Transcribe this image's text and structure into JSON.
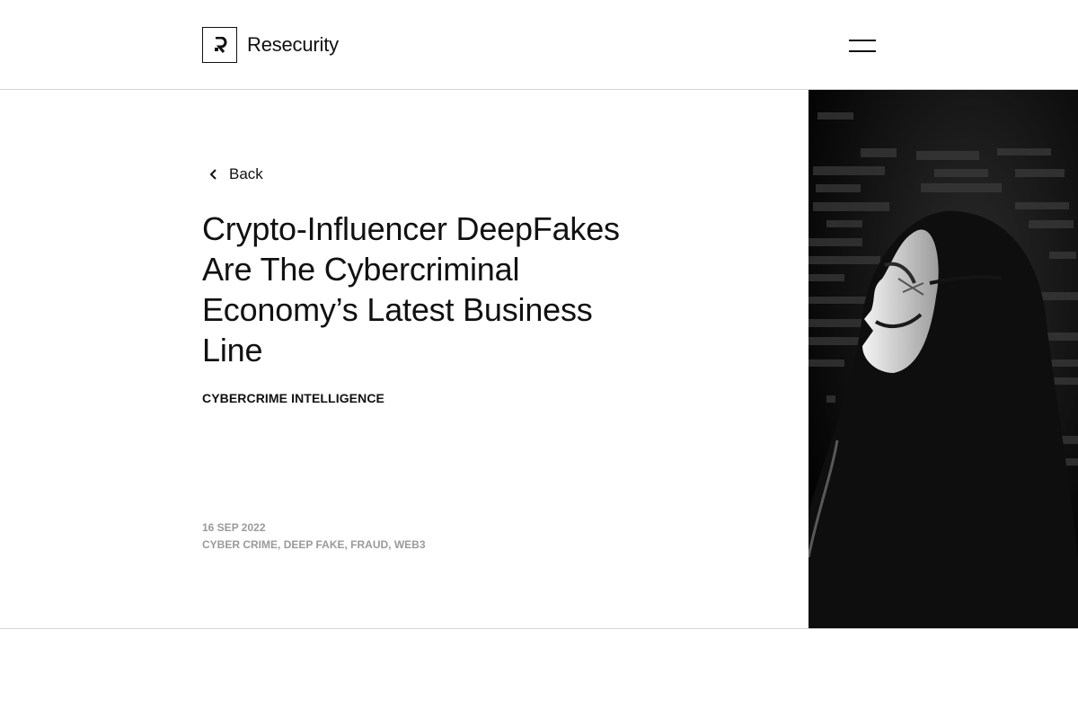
{
  "header": {
    "logo_text": "Resecurity",
    "logo_icon": "resecurity-logo-icon",
    "menu_icon": "hamburger-menu-icon"
  },
  "article": {
    "back_label": "Back",
    "back_icon": "chevron-left-icon",
    "title": "Crypto-Influencer DeepFakes Are The Cybercriminal Economy’s Latest Business Line",
    "category": "CYBERCRIME INTELLIGENCE",
    "date": "16 SEP 2022",
    "tags": [
      "CYBER CRIME",
      "DEEP FAKE",
      "FRAUD",
      "WEB3"
    ],
    "tag_separator": ", ",
    "image_alt": "hooded-figure-with-mask-image"
  },
  "colors": {
    "text": "#111111",
    "meta": "#9a9a9a",
    "divider": "#d6d6d6",
    "image_bg": "#050505"
  }
}
